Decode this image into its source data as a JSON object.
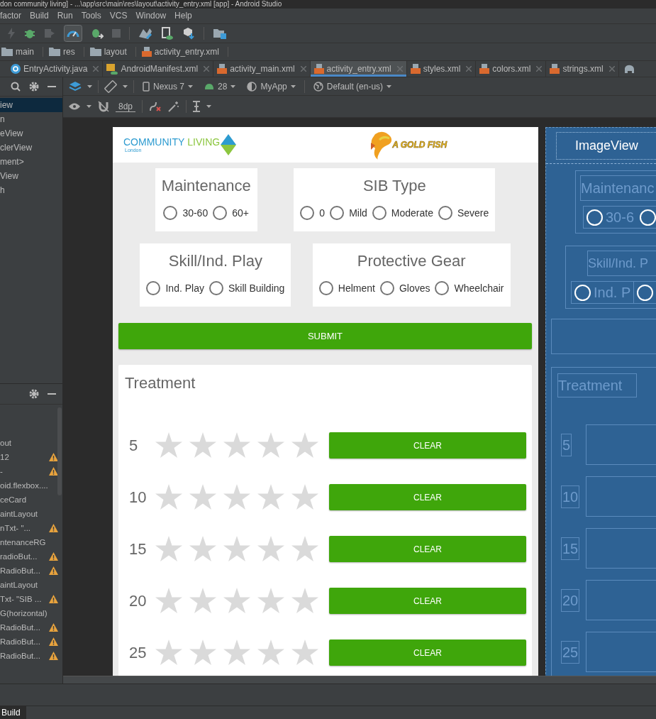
{
  "window": {
    "title": "don community living] - ...\\app\\src\\main\\res\\layout\\activity_entry.xml [app] - Android Studio"
  },
  "menu": [
    "factor",
    "Build",
    "Run",
    "Tools",
    "VCS",
    "Window",
    "Help"
  ],
  "breadcrumb": [
    "main",
    "res",
    "layout",
    "activity_entry.xml"
  ],
  "tabs": [
    {
      "label": "EntryActivity.java",
      "kind": "java",
      "selected": false
    },
    {
      "label": "AndroidManifest.xml",
      "kind": "manifest",
      "selected": false
    },
    {
      "label": "activity_main.xml",
      "kind": "xml",
      "selected": false
    },
    {
      "label": "activity_entry.xml",
      "kind": "xml",
      "selected": true
    },
    {
      "label": "styles.xml",
      "kind": "xml",
      "selected": false
    },
    {
      "label": "colors.xml",
      "kind": "xml",
      "selected": false
    },
    {
      "label": "strings.xml",
      "kind": "xml",
      "selected": false
    }
  ],
  "design_toolbar": {
    "device": "Nexus 7",
    "api": "28",
    "theme": "MyApp",
    "locale": "Default (en-us)",
    "margin": "8dp"
  },
  "palette": {
    "items": [
      {
        "label": "iew",
        "selected": true
      },
      {
        "label": "n",
        "selected": false
      },
      {
        "label": "eView",
        "selected": false
      },
      {
        "label": "clerView",
        "selected": false
      },
      {
        "label": "ment>",
        "selected": false
      },
      {
        "label": "View",
        "selected": false
      },
      {
        "label": "h",
        "selected": false
      }
    ]
  },
  "component_tree": {
    "items": [
      {
        "label": "out",
        "warning": false
      },
      {
        "label": "12",
        "warning": true
      },
      {
        "label": "-",
        "warning": true
      },
      {
        "label": "oid.flexbox....",
        "warning": false
      },
      {
        "label": "ceCard",
        "warning": false
      },
      {
        "label": "aintLayout",
        "warning": false
      },
      {
        "label": "nTxt- \"...",
        "warning": true
      },
      {
        "label": "ntenanceRG",
        "warning": false
      },
      {
        "label": "radioBut...",
        "warning": true
      },
      {
        "label": "RadioBut...",
        "warning": true
      },
      {
        "label": "aintLayout",
        "warning": false
      },
      {
        "label": "Txt- \"SIB ...",
        "warning": true
      },
      {
        "label": "G(horizontal)",
        "warning": false
      },
      {
        "label": "RadioBut...",
        "warning": true
      },
      {
        "label": "RadioBut...",
        "warning": true
      },
      {
        "label": "RadioBut...",
        "warning": true
      }
    ]
  },
  "device_screen": {
    "logo_left": {
      "word_1": "COMMUNITY",
      "word_2": "LIVING",
      "subtitle": "London"
    },
    "logo_right": "A GOLD FISH",
    "group_rows": [
      [
        {
          "title": "Maintenance",
          "options": [
            {
              "label": "30-60",
              "selected": false
            },
            {
              "label": "60+",
              "selected": false
            }
          ]
        },
        {
          "title": "SIB Type",
          "options": [
            {
              "label": "0",
              "selected": false
            },
            {
              "label": "Mild",
              "selected": false
            },
            {
              "label": "Moderate",
              "selected": false
            },
            {
              "label": "Severe",
              "selected": false
            }
          ]
        }
      ],
      [
        {
          "title": "Skill/Ind. Play",
          "options": [
            {
              "label": "Ind. Play",
              "selected": false
            },
            {
              "label": "Skill Building",
              "selected": false
            }
          ]
        },
        {
          "title": "Protective Gear",
          "options": [
            {
              "label": "Helment",
              "selected": false
            },
            {
              "label": "Gloves",
              "selected": false
            },
            {
              "label": "Wheelchair",
              "selected": false
            }
          ]
        }
      ]
    ],
    "submit": "SUBMIT",
    "treatment": {
      "title": "Treatment",
      "rows": [
        {
          "label": "5",
          "stars": 0,
          "button": "CLEAR"
        },
        {
          "label": "10",
          "stars": 0,
          "button": "CLEAR"
        },
        {
          "label": "15",
          "stars": 0,
          "button": "CLEAR"
        },
        {
          "label": "20",
          "stars": 0,
          "button": "CLEAR"
        },
        {
          "label": "25",
          "stars": 0,
          "button": "CLEAR"
        }
      ]
    }
  },
  "blueprint": {
    "header": "ImageView",
    "maintenance_title": "Maintenanc",
    "maintenance_option": "30-6",
    "skill_title": "Skill/Ind. P",
    "skill_option": "Ind. P",
    "treatment_title": "Treatment",
    "rows": [
      "5",
      "10",
      "15",
      "20",
      "25"
    ]
  },
  "bottom_tabs": [
    {
      "label": "Build",
      "selected": true
    }
  ]
}
